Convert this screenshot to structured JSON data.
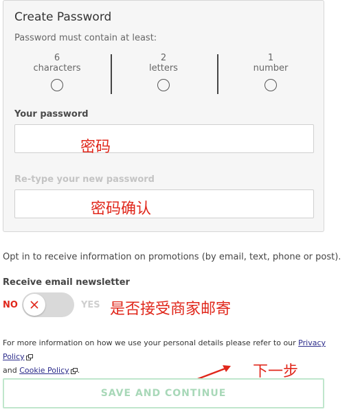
{
  "form": {
    "title": "Create Password",
    "subtitle": "Password must contain at least:",
    "requirements": [
      {
        "count": "6",
        "unit": "characters"
      },
      {
        "count": "2",
        "unit": "letters"
      },
      {
        "count": "1",
        "unit": "number"
      }
    ],
    "password_label": "Your password",
    "password_value": "",
    "retype_label": "Re-type your new password",
    "retype_value": ""
  },
  "annotations": {
    "password": "密码",
    "retype": "密码确认",
    "newsletter": "是否接受商家邮寄",
    "next": "下一步"
  },
  "optin": {
    "text": "Opt in to receive information on promotions (by email, text, phone or post).",
    "newsletter_label": "Receive email newsletter",
    "no_label": "NO",
    "yes_label": "YES",
    "toggle_state": "off"
  },
  "info": {
    "text_before": "For more information on how we use your personal details please refer to our",
    "privacy_link": "Privacy Policy",
    "and": "and",
    "cookie_link": "Cookie Policy",
    "end": "."
  },
  "cta": {
    "label": "SAVE AND CONTINUE"
  },
  "colors": {
    "annotation": "#e0271b",
    "cta_border": "#bfe6cc",
    "cta_text": "#a8d8b8",
    "no_label": "#e0271b"
  }
}
